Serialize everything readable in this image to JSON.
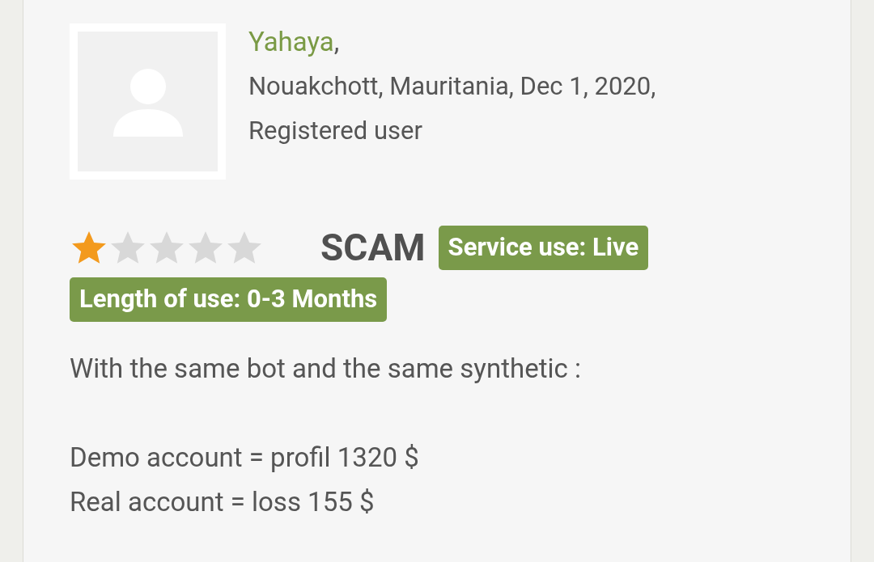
{
  "review": {
    "author": "Yahaya",
    "author_suffix": ",",
    "location_date": "Nouakchott, Mauritania, Dec 1, 2020,",
    "user_type": "Registered user",
    "stars": 1,
    "verdict": "SCAM",
    "badges": [
      "Service use: Live",
      "Length of use: 0-3 Months"
    ],
    "body": [
      "With the same bot and the same synthetic :",
      "Demo account = profil 1320 $\nReal account = loss 155 $"
    ]
  }
}
